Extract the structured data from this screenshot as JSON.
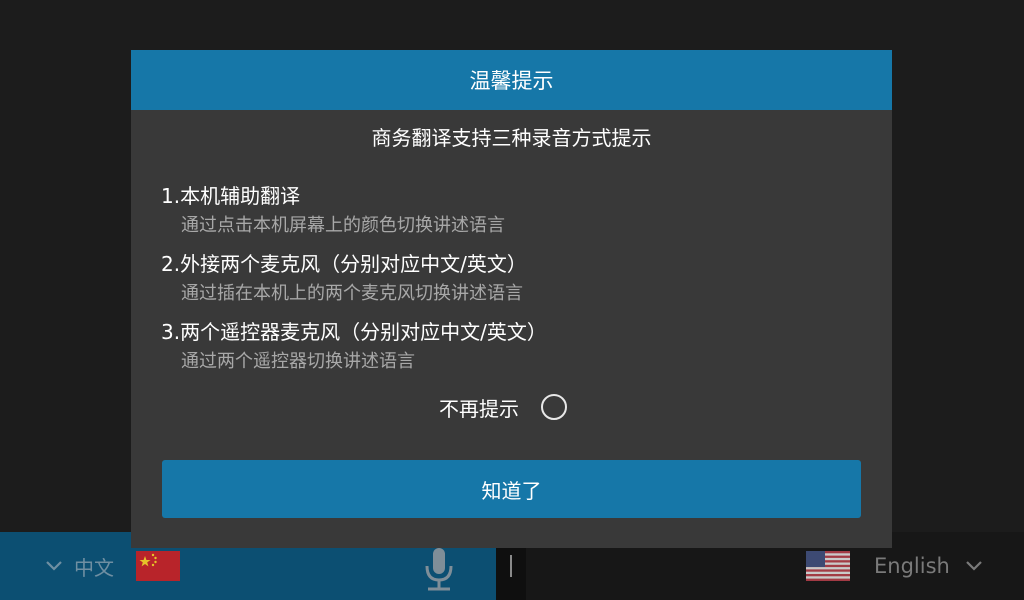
{
  "dialog": {
    "title": "温馨提示",
    "subtitle": "商务翻译支持三种录音方式提示",
    "items": [
      {
        "title": "1.本机辅助翻译",
        "desc": "通过点击本机屏幕上的颜色切换讲述语言"
      },
      {
        "title": "2.外接两个麦克风（分别对应中文/英文）",
        "desc": "通过插在本机上的两个麦克风切换讲述语言"
      },
      {
        "title": "3.两个遥控器麦克风（分别对应中文/英文）",
        "desc": "通过两个遥控器切换讲述语言"
      }
    ],
    "no_remind_label": "不再提示",
    "no_remind_checked": false,
    "confirm_label": "知道了"
  },
  "bottom_bar": {
    "left_language": "中文",
    "right_language": "English",
    "left_flag_icon": "china-flag-icon",
    "right_flag_icon": "us-flag-icon",
    "mic_icon": "microphone-icon"
  },
  "colors": {
    "accent": "#1677a8",
    "dialog_bg": "#393939",
    "left_panel": "#0c4f72"
  }
}
